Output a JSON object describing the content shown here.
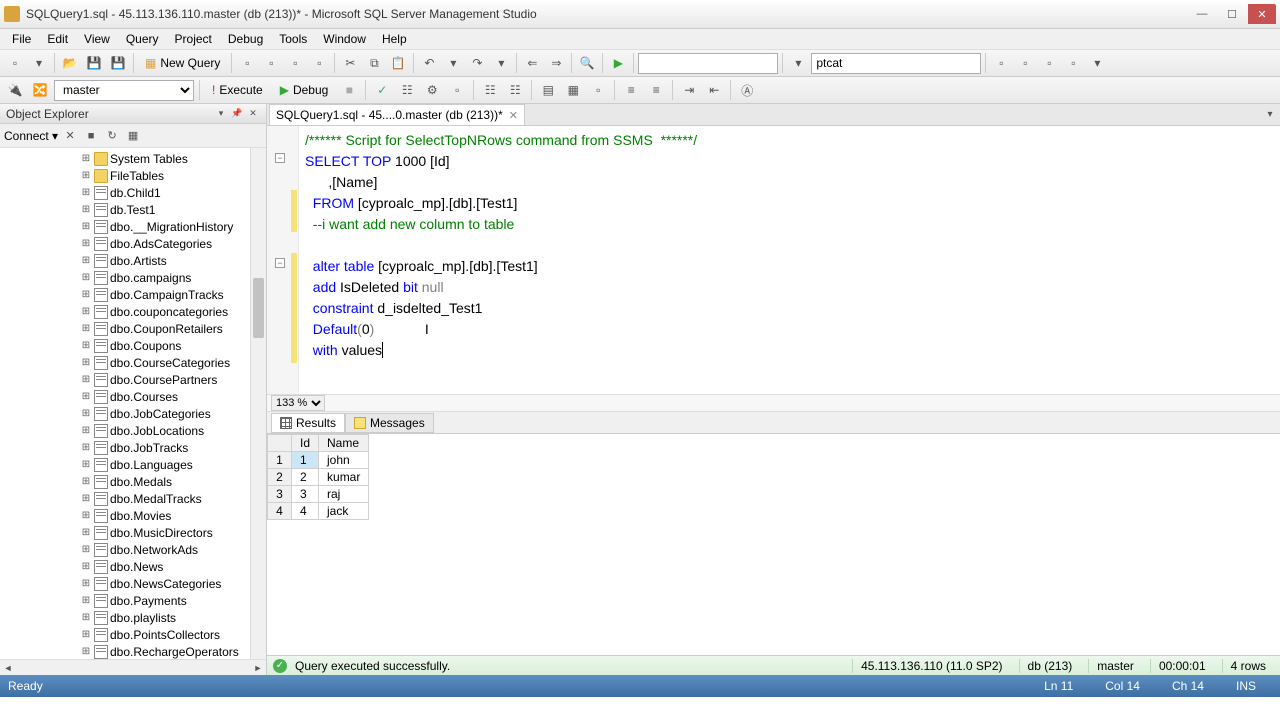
{
  "titlebar": {
    "text": "SQLQuery1.sql - 45.113.136.110.master (db (213))* - Microsoft SQL Server Management Studio"
  },
  "menu": [
    "File",
    "Edit",
    "View",
    "Query",
    "Project",
    "Debug",
    "Tools",
    "Window",
    "Help"
  ],
  "toolbar1": {
    "new_query": "New Query",
    "login_combo": "ptcat"
  },
  "toolbar2": {
    "db_combo": "master",
    "execute": "Execute",
    "debug": "Debug"
  },
  "objexp": {
    "title": "Object Explorer",
    "connect": "Connect",
    "items": [
      {
        "type": "folder",
        "label": "System Tables"
      },
      {
        "type": "folder",
        "label": "FileTables"
      },
      {
        "type": "table",
        "label": "db.Child1"
      },
      {
        "type": "table",
        "label": "db.Test1"
      },
      {
        "type": "table",
        "label": "dbo.__MigrationHistory"
      },
      {
        "type": "table",
        "label": "dbo.AdsCategories"
      },
      {
        "type": "table",
        "label": "dbo.Artists"
      },
      {
        "type": "table",
        "label": "dbo.campaigns"
      },
      {
        "type": "table",
        "label": "dbo.CampaignTracks"
      },
      {
        "type": "table",
        "label": "dbo.couponcategories"
      },
      {
        "type": "table",
        "label": "dbo.CouponRetailers"
      },
      {
        "type": "table",
        "label": "dbo.Coupons"
      },
      {
        "type": "table",
        "label": "dbo.CourseCategories"
      },
      {
        "type": "table",
        "label": "dbo.CoursePartners"
      },
      {
        "type": "table",
        "label": "dbo.Courses"
      },
      {
        "type": "table",
        "label": "dbo.JobCategories"
      },
      {
        "type": "table",
        "label": "dbo.JobLocations"
      },
      {
        "type": "table",
        "label": "dbo.JobTracks"
      },
      {
        "type": "table",
        "label": "dbo.Languages"
      },
      {
        "type": "table",
        "label": "dbo.Medals"
      },
      {
        "type": "table",
        "label": "dbo.MedalTracks"
      },
      {
        "type": "table",
        "label": "dbo.Movies"
      },
      {
        "type": "table",
        "label": "dbo.MusicDirectors"
      },
      {
        "type": "table",
        "label": "dbo.NetworkAds"
      },
      {
        "type": "table",
        "label": "dbo.News"
      },
      {
        "type": "table",
        "label": "dbo.NewsCategories"
      },
      {
        "type": "table",
        "label": "dbo.Payments"
      },
      {
        "type": "table",
        "label": "dbo.playlists"
      },
      {
        "type": "table",
        "label": "dbo.PointsCollectors"
      },
      {
        "type": "table",
        "label": "dbo.RechargeOperators"
      }
    ]
  },
  "tab": {
    "label": "SQLQuery1.sql - 45....0.master (db (213))*"
  },
  "code": {
    "l1": "/****** Script for SelectTopNRows command from SSMS  ******/",
    "l2a": "SELECT",
    "l2b": " TOP",
    "l2c": " 1000 [Id]",
    "l3": "      ,[Name]",
    "l4a": "  FROM",
    "l4b": " [cyproalc_mp].[db].[Test1]",
    "l5": "  --i want add new column to table",
    "l6": "",
    "l7a": "  alter",
    "l7b": " table",
    "l7c": " [cyproalc_mp].[db].[Test1]",
    "l8a": "  add",
    "l8b": " IsDeleted ",
    "l8c": "bit",
    "l8d": " null",
    "l9a": "  constraint",
    "l9b": " d_isdelted_Test1",
    "l10a": "  Default",
    "l10b": "(",
    "l10c": "0",
    "l10d": ")",
    "l11a": "  with",
    "l11b": " values"
  },
  "zoom": "133 %",
  "results": {
    "tab_results": "Results",
    "tab_messages": "Messages",
    "cols": [
      "Id",
      "Name"
    ],
    "rows": [
      {
        "n": "1",
        "id": "1",
        "name": "john"
      },
      {
        "n": "2",
        "id": "2",
        "name": "kumar"
      },
      {
        "n": "3",
        "id": "3",
        "name": "raj"
      },
      {
        "n": "4",
        "id": "4",
        "name": "jack"
      }
    ]
  },
  "qstatus": {
    "msg": "Query executed successfully.",
    "server": "45.113.136.110 (11.0 SP2)",
    "db": "db (213)",
    "dbname": "master",
    "time": "00:00:01",
    "rows": "4 rows"
  },
  "status": {
    "ready": "Ready",
    "ln": "Ln 11",
    "col": "Col 14",
    "ch": "Ch 14",
    "ins": "INS"
  }
}
